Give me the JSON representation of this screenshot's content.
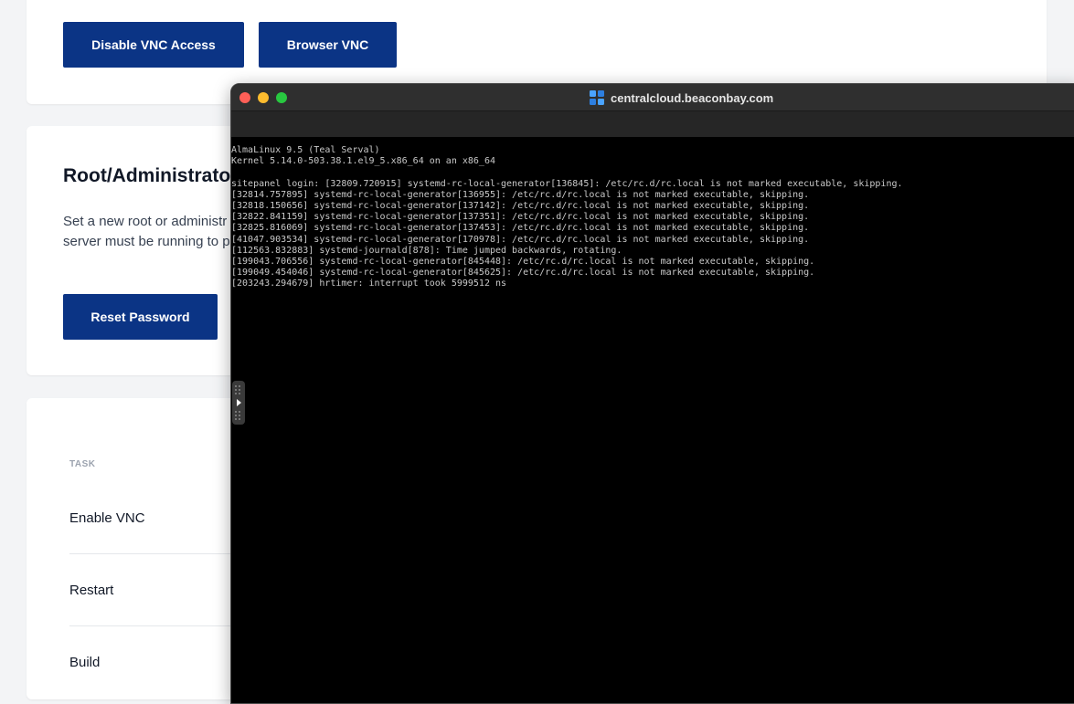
{
  "vnc_card": {
    "disable_button": "Disable VNC Access",
    "browser_button": "Browser VNC"
  },
  "root_card": {
    "title": "Root/Administrato",
    "description_line1": "Set a new root or administr",
    "description_line2": "server must be running to p",
    "reset_button": "Reset Password"
  },
  "tasks_card": {
    "header": "TASK",
    "rows": [
      {
        "label": "Enable VNC"
      },
      {
        "label": "Restart"
      },
      {
        "label": "Build"
      }
    ]
  },
  "vnc_window": {
    "title": "centralcloud.beaconbay.com",
    "app_icon": "grid-icon",
    "traffic_colors": {
      "close": "#fe5f57",
      "minimize": "#febc2e",
      "maximize": "#28c840"
    },
    "console_lines": [
      "AlmaLinux 9.5 (Teal Serval)",
      "Kernel 5.14.0-503.38.1.el9_5.x86_64 on an x86_64",
      "",
      "sitepanel login: [32809.720915] systemd-rc-local-generator[136845]: /etc/rc.d/rc.local is not marked executable, skipping.",
      "[32814.757895] systemd-rc-local-generator[136955]: /etc/rc.d/rc.local is not marked executable, skipping.",
      "[32818.150656] systemd-rc-local-generator[137142]: /etc/rc.d/rc.local is not marked executable, skipping.",
      "[32822.841159] systemd-rc-local-generator[137351]: /etc/rc.d/rc.local is not marked executable, skipping.",
      "[32825.816069] systemd-rc-local-generator[137453]: /etc/rc.d/rc.local is not marked executable, skipping.",
      "[41047.903534] systemd-rc-local-generator[170978]: /etc/rc.d/rc.local is not marked executable, skipping.",
      "[112563.832883] systemd-journald[878]: Time jumped backwards, rotating.",
      "[199043.706556] systemd-rc-local-generator[845448]: /etc/rc.d/rc.local is not marked executable, skipping.",
      "[199049.454046] systemd-rc-local-generator[845625]: /etc/rc.d/rc.local is not marked executable, skipping.",
      "[203243.294679] hrtimer: interrupt took 5999512 ns"
    ]
  },
  "colors": {
    "primary_button": "#0b3485",
    "page_background": "#f3f4f6",
    "console_background": "#000000",
    "console_text": "#c9c9c9"
  }
}
